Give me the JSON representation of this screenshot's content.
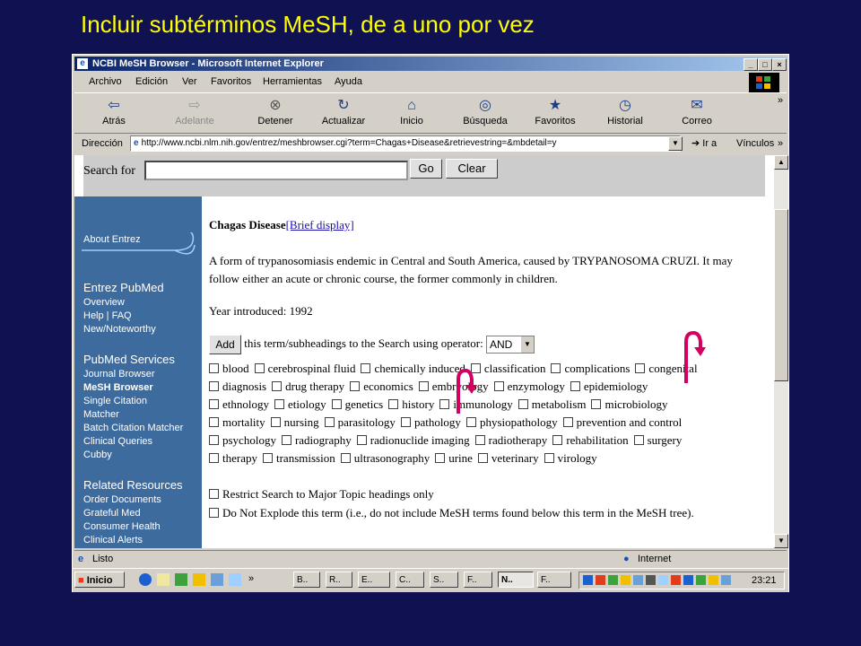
{
  "slide": {
    "title": "Incluir subtérminos MeSH, de a uno por vez"
  },
  "window": {
    "title": "NCBI MeSH Browser - Microsoft Internet Explorer"
  },
  "menu": [
    "Archivo",
    "Edición",
    "Ver",
    "Favoritos",
    "Herramientas",
    "Ayuda"
  ],
  "toolbar": [
    {
      "label": "Atrás",
      "icon": "back-arrow-icon"
    },
    {
      "label": "Adelante",
      "icon": "forward-arrow-icon"
    },
    {
      "label": "Detener",
      "icon": "stop-icon"
    },
    {
      "label": "Actualizar",
      "icon": "refresh-icon"
    },
    {
      "label": "Inicio",
      "icon": "home-icon"
    },
    {
      "label": "Búsqueda",
      "icon": "search-icon"
    },
    {
      "label": "Favoritos",
      "icon": "favorites-icon"
    },
    {
      "label": "Historial",
      "icon": "history-icon"
    },
    {
      "label": "Correo",
      "icon": "mail-icon"
    }
  ],
  "address": {
    "label": "Dirección",
    "url": "http://www.ncbi.nlm.nih.gov/entrez/meshbrowser.cgi?term=Chagas+Disease&retrievestring=&mbdetail=y",
    "go": "Ir a",
    "links": "Vínculos"
  },
  "search": {
    "label": "Search for",
    "go": "Go",
    "clear": "Clear"
  },
  "sidebar": {
    "about": "About Entrez",
    "pubmed_header": "Entrez PubMed",
    "pubmed_items": [
      "Overview",
      "Help | FAQ",
      "New/Noteworthy"
    ],
    "services_header": "PubMed Services",
    "services_items": [
      "Journal Browser",
      "MeSH Browser",
      "Single Citation",
      "Matcher",
      "Batch Citation Matcher",
      "Clinical Queries",
      "Cubby"
    ],
    "related_header": "Related Resources",
    "related_items": [
      "Order Documents",
      "Grateful Med",
      "Consumer Health",
      "Clinical Alerts"
    ]
  },
  "term": {
    "name": "Chagas Disease",
    "brief_link": "[Brief display]",
    "definition": "A form of trypanosomiasis endemic in Central and South America, caused by TRYPANOSOMA CRUZI. It may follow either an acute or chronic course, the former commonly in children.",
    "year": "Year introduced: 1992",
    "add_button": "Add",
    "add_text": "this term/subheadings to the Search using operator:",
    "operator": "AND"
  },
  "subheadings": [
    [
      "blood",
      "cerebrospinal fluid",
      "chemically induced",
      "classification",
      "complications",
      "congenital"
    ],
    [
      "diagnosis",
      "drug therapy",
      "economics",
      "embryology",
      "enzymology",
      "epidemiology"
    ],
    [
      "ethnology",
      "etiology",
      "genetics",
      "history",
      "immunology",
      "metabolism",
      "microbiology"
    ],
    [
      "mortality",
      "nursing",
      "parasitology",
      "pathology",
      "physiopathology",
      "prevention and control"
    ],
    [
      "psychology",
      "radiography",
      "radionuclide imaging",
      "radiotherapy",
      "rehabilitation",
      "surgery"
    ],
    [
      "therapy",
      "transmission",
      "ultrasonography",
      "urine",
      "veterinary",
      "virology"
    ]
  ],
  "options": {
    "major": "Restrict Search to Major Topic headings only",
    "noexplode": "Do Not Explode this term (i.e., do not include MeSH terms found below this term in the MeSH tree)."
  },
  "status": {
    "text": "Listo",
    "zone": "Internet"
  },
  "taskbar": {
    "start": "Inicio",
    "more": "»",
    "tasks": [
      "B..",
      "R..",
      "E..",
      "C..",
      "S..",
      "F..",
      "N..",
      "F.."
    ],
    "clock": "23:21"
  },
  "colors": {
    "slide_bg": "#0f1150",
    "title": "#ffff00",
    "sidebar": "#3d6b9e",
    "arrow": "#d40060"
  }
}
